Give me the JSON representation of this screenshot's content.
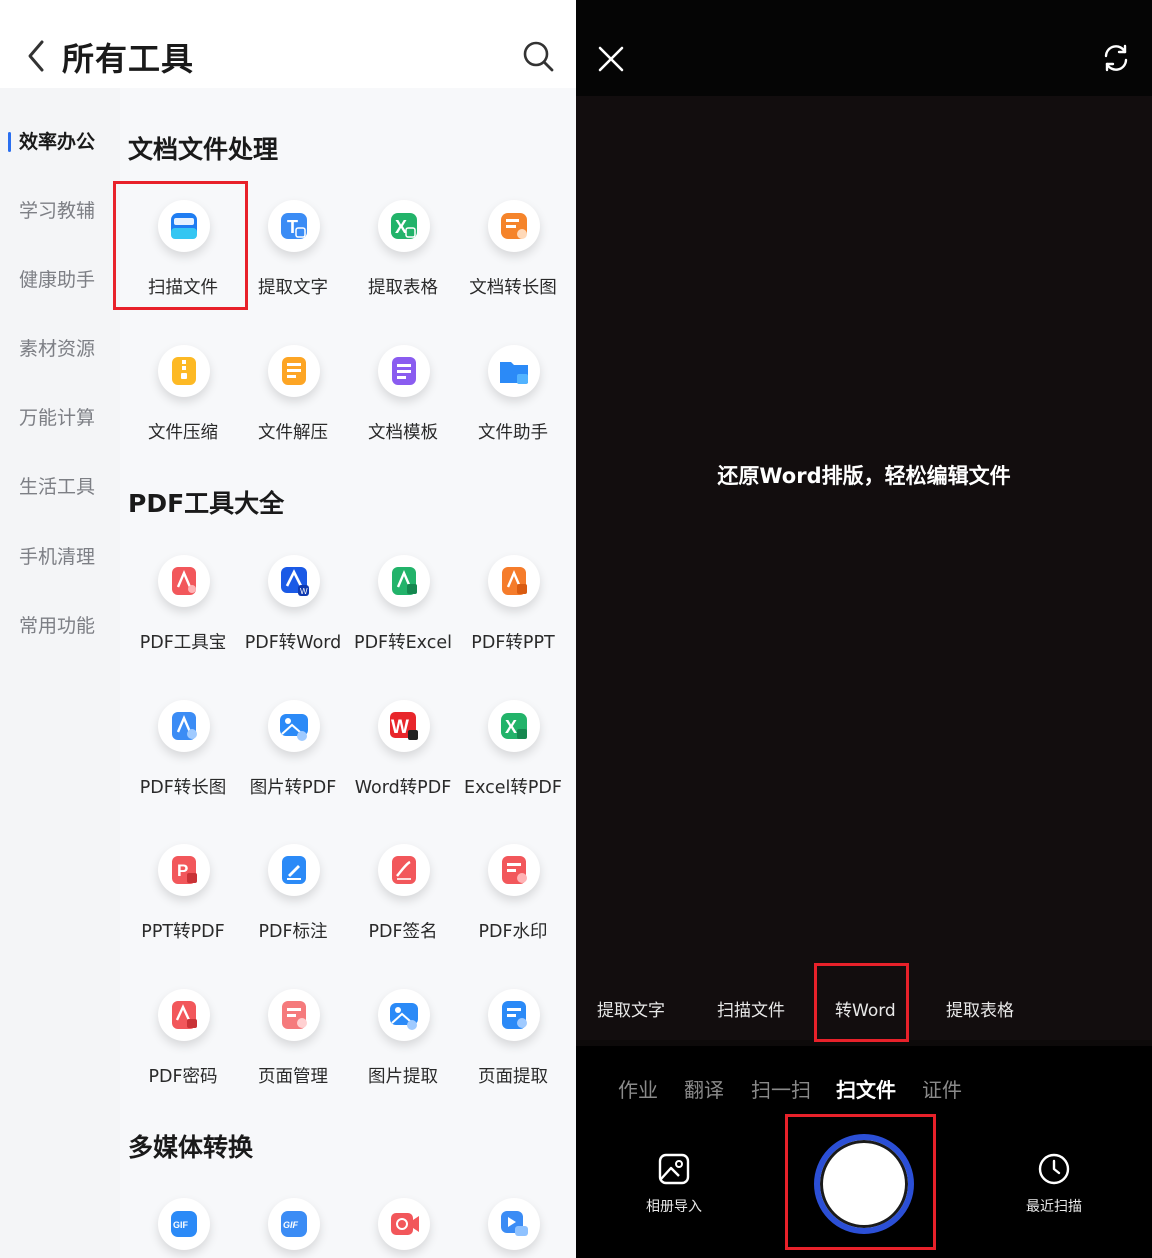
{
  "left": {
    "header": {
      "title": "所有工具"
    },
    "sidebar": {
      "items": [
        {
          "label": "效率办公",
          "active": true
        },
        {
          "label": "学习教辅"
        },
        {
          "label": "健康助手"
        },
        {
          "label": "素材资源"
        },
        {
          "label": "万能计算"
        },
        {
          "label": "生活工具"
        },
        {
          "label": "手机清理"
        },
        {
          "label": "常用功能"
        }
      ]
    },
    "sections": [
      {
        "title": "文档文件处理",
        "tools": [
          {
            "label": "扫描文件",
            "icon": "scan-doc-icon",
            "highlighted": true
          },
          {
            "label": "提取文字",
            "icon": "extract-text-icon"
          },
          {
            "label": "提取表格",
            "icon": "extract-table-icon"
          },
          {
            "label": "文档转长图",
            "icon": "doc-long-image-icon"
          },
          {
            "label": "文件压缩",
            "icon": "file-compress-icon"
          },
          {
            "label": "文件解压",
            "icon": "file-decompress-icon"
          },
          {
            "label": "文档模板",
            "icon": "doc-template-icon"
          },
          {
            "label": "文件助手",
            "icon": "file-assistant-icon"
          }
        ]
      },
      {
        "title": "PDF工具大全",
        "tools": [
          {
            "label": "PDF工具宝",
            "icon": "pdf-toolbox-icon"
          },
          {
            "label": "PDF转Word",
            "icon": "pdf-to-word-icon"
          },
          {
            "label": "PDF转Excel",
            "icon": "pdf-to-excel-icon"
          },
          {
            "label": "PDF转PPT",
            "icon": "pdf-to-ppt-icon"
          },
          {
            "label": "PDF转长图",
            "icon": "pdf-long-image-icon"
          },
          {
            "label": "图片转PDF",
            "icon": "image-to-pdf-icon"
          },
          {
            "label": "Word转PDF",
            "icon": "word-to-pdf-icon"
          },
          {
            "label": "Excel转PDF",
            "icon": "excel-to-pdf-icon"
          },
          {
            "label": "PPT转PDF",
            "icon": "ppt-to-pdf-icon"
          },
          {
            "label": "PDF标注",
            "icon": "pdf-annotate-icon"
          },
          {
            "label": "PDF签名",
            "icon": "pdf-sign-icon"
          },
          {
            "label": "PDF水印",
            "icon": "pdf-watermark-icon"
          },
          {
            "label": "PDF密码",
            "icon": "pdf-password-icon"
          },
          {
            "label": "页面管理",
            "icon": "page-manage-icon"
          },
          {
            "label": "图片提取",
            "icon": "image-extract-icon"
          },
          {
            "label": "页面提取",
            "icon": "page-extract-icon"
          }
        ]
      },
      {
        "title": "多媒体转换",
        "tools": [
          {
            "label": "",
            "icon": "gif-icon"
          },
          {
            "label": "",
            "icon": "gif-make-icon"
          },
          {
            "label": "",
            "icon": "video-convert-icon"
          },
          {
            "label": "",
            "icon": "video-gif-icon"
          }
        ]
      }
    ]
  },
  "right": {
    "hint": "还原Word排版，轻松编辑文件",
    "sub_modes": [
      {
        "label": "提取文字"
      },
      {
        "label": "扫描文件"
      },
      {
        "label": "转Word",
        "highlighted": true
      },
      {
        "label": "提取表格"
      }
    ],
    "modes": [
      {
        "label": "作业"
      },
      {
        "label": "翻译"
      },
      {
        "label": "扫一扫"
      },
      {
        "label": "扫文件",
        "active": true
      },
      {
        "label": "证件"
      }
    ],
    "album_label": "相册导入",
    "recent_label": "最近扫描"
  },
  "colors": {
    "accent_blue": "#2a6ff0",
    "highlight_red": "#e8212a",
    "shutter_ring": "#2b4fd6"
  }
}
